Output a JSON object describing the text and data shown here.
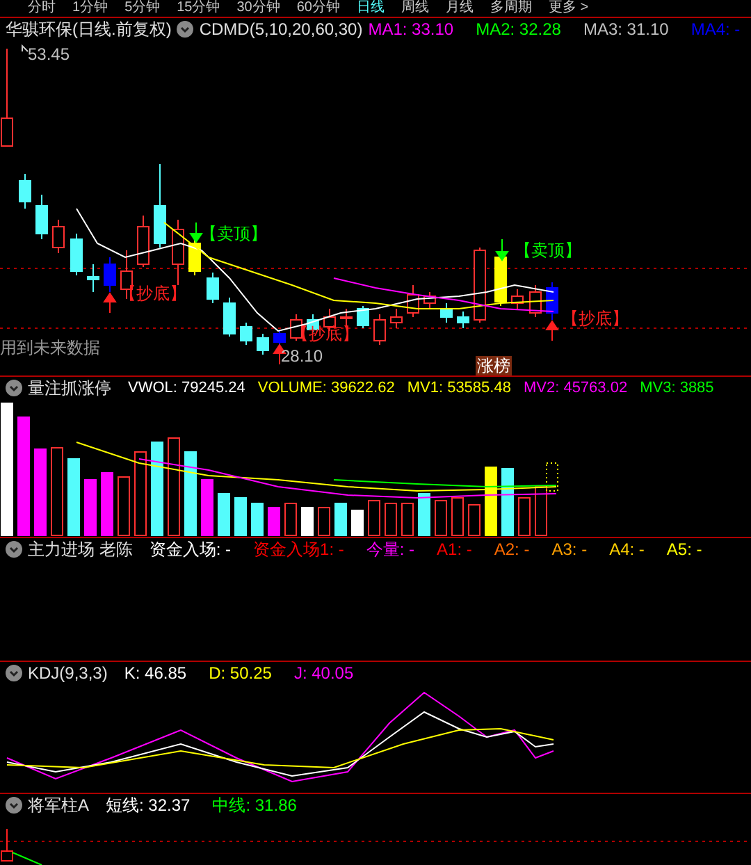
{
  "period_tabs": [
    {
      "label": "分时",
      "selected": false
    },
    {
      "label": "1分钟",
      "selected": false
    },
    {
      "label": "5分钟",
      "selected": false
    },
    {
      "label": "15分钟",
      "selected": false
    },
    {
      "label": "30分钟",
      "selected": false
    },
    {
      "label": "60分钟",
      "selected": false
    },
    {
      "label": "日线",
      "selected": true
    },
    {
      "label": "周线",
      "selected": false
    },
    {
      "label": "月线",
      "selected": false
    },
    {
      "label": "多周期",
      "selected": false
    },
    {
      "label": "更多 >",
      "selected": false
    }
  ],
  "main_panel": {
    "title": "华骐环保(日线.前复权)",
    "indicator": "CDMD(5,10,20,60,30)",
    "readings": [
      {
        "text": "MA1: 33.10",
        "color": "#ff00ff"
      },
      {
        "text": "MA2: 32.28",
        "color": "#00ff00"
      },
      {
        "text": "MA3: 31.10",
        "color": "#c0c0c0"
      },
      {
        "text": "MA4: -",
        "color": "#0000ff"
      }
    ],
    "annotations": [
      {
        "kind": "high",
        "text": "53.45"
      },
      {
        "kind": "sell",
        "text": "【卖顶】"
      },
      {
        "kind": "sell",
        "text": "【卖顶】"
      },
      {
        "kind": "buy",
        "text": "【抄底】"
      },
      {
        "kind": "buy",
        "text": "【抄底】"
      },
      {
        "kind": "buy",
        "text": "【抄底】"
      },
      {
        "kind": "note",
        "text": "用到未来数据"
      },
      {
        "kind": "low",
        "text": "28.10"
      },
      {
        "kind": "badge",
        "text": "涨榜"
      }
    ]
  },
  "indicator_panels": [
    {
      "title": "量注抓涨停",
      "kind": "volume",
      "readings": [
        {
          "text": "VWOL: 79245.24",
          "color": "#ffffff"
        },
        {
          "text": "VOLUME: 39622.62",
          "color": "#ffff00"
        },
        {
          "text": "MV1: 53585.48",
          "color": "#ffff00"
        },
        {
          "text": "MV2: 45763.02",
          "color": "#ff00ff"
        },
        {
          "text": "MV3: 3885",
          "color": "#00ff00"
        }
      ]
    },
    {
      "title": "主力进场 老陈",
      "kind": "empty",
      "readings": [
        {
          "text": "资金入场: -",
          "color": "#ffffff"
        },
        {
          "text": "资金入场1: -",
          "color": "#ff0000"
        },
        {
          "text": "今量: -",
          "color": "#ff00ff"
        },
        {
          "text": "A1: -",
          "color": "#ff0000"
        },
        {
          "text": "A2: -",
          "color": "#ff6a00"
        },
        {
          "text": "A3: -",
          "color": "#ffa000"
        },
        {
          "text": "A4: -",
          "color": "#ffd000"
        },
        {
          "text": "A5: -",
          "color": "#ffff00"
        }
      ]
    },
    {
      "title": "KDJ(9,3,3)",
      "kind": "kdj",
      "readings": [
        {
          "text": "K: 46.85",
          "color": "#ffffff"
        },
        {
          "text": "D: 50.25",
          "color": "#ffff00"
        },
        {
          "text": "J: 40.05",
          "color": "#ff00ff"
        }
      ]
    },
    {
      "title": "将军柱A",
      "kind": "general",
      "readings": [
        {
          "text": "短线: 32.37",
          "color": "#ffffff"
        },
        {
          "text": "中线: 31.86",
          "color": "#00ff00"
        }
      ]
    }
  ]
}
